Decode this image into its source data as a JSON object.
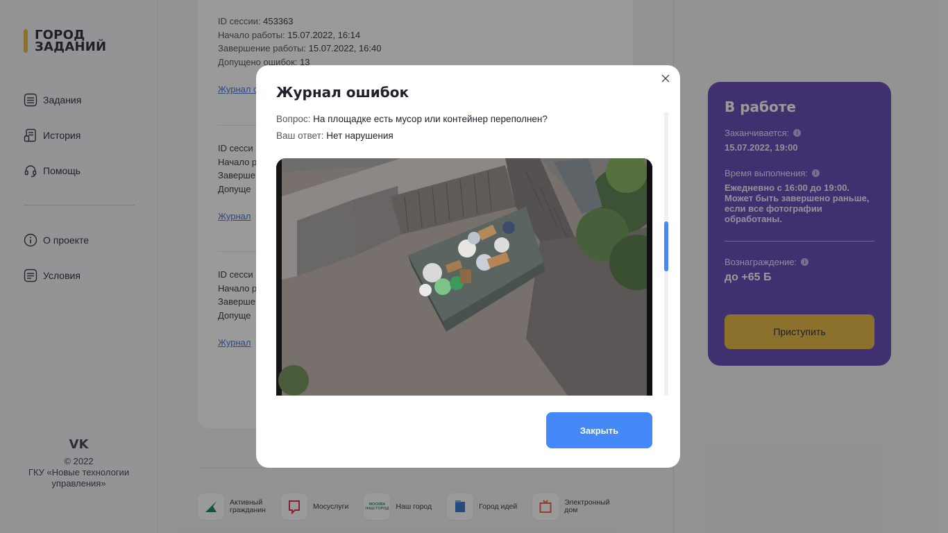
{
  "brand": {
    "logo_line1": "ГОРОД",
    "logo_line2": "ЗАДАНИЙ",
    "accent": "#e3b436"
  },
  "sidebar": {
    "items": [
      {
        "label": "Задания",
        "icon": "list-icon"
      },
      {
        "label": "История",
        "icon": "history-icon"
      },
      {
        "label": "Помощь",
        "icon": "headset-icon"
      }
    ],
    "secondary": [
      {
        "label": "О проекте",
        "icon": "info-icon"
      },
      {
        "label": "Условия",
        "icon": "document-icon"
      }
    ],
    "footer": {
      "vk": "VK",
      "copyright": "© 2022",
      "org": "ГКУ «Новые технологии управления»"
    }
  },
  "sessions": {
    "first": {
      "id_label": "ID сессии:",
      "id_value": "453363",
      "start_label": "Начало работы:",
      "start_value": "15.07.2022, 16:14",
      "end_label": "Завершение работы:",
      "end_value": "15.07.2022, 16:40",
      "errors_label": "Допущено ошибок:",
      "errors_value": "13",
      "journal_link": "Журнал ошибок"
    },
    "second": {
      "l1": "ID сесси",
      "l2": "Начало р",
      "l3": "Заверше",
      "l4": "Допуще",
      "link": "Журнал"
    },
    "third": {
      "l1": "ID сесси",
      "l2": "Начало р",
      "l3": "Заверше",
      "l4": "Допуще",
      "link": "Журнал"
    }
  },
  "partners": [
    {
      "name": "Активный гражданин",
      "line1": "Активный",
      "line2": "гражданин",
      "color": "#0b7c6e"
    },
    {
      "name": "Мосуслуги",
      "line1": "Мосуслуги",
      "line2": "",
      "color": "#d7263d"
    },
    {
      "name": "Наш город",
      "line1": "Наш город",
      "line2": "",
      "color": "#2b8a56",
      "logo_text_1": "МОСКВА",
      "logo_text_2": "НАШ ГОРОД"
    },
    {
      "name": "Город идей",
      "line1": "Город идей",
      "line2": "",
      "color": "#2a6fcc"
    },
    {
      "name": "Электронный дом",
      "line1": "Электронный",
      "line2": "дом",
      "color": "#e65c2c"
    }
  ],
  "status_card": {
    "title": "В работе",
    "ends_label": "Заканчивается:",
    "ends_value": "15.07.2022, 19:00",
    "time_label": "Время выполнения:",
    "time_value": "Ежедневно с 16:00 до 19:00. Может быть завершено раньше, если все фотографии обработаны.",
    "reward_label": "Вознаграждение:",
    "reward_value": "до +65 Б",
    "start_button": "Приступить",
    "bg_color": "#5b3fb3"
  },
  "modal": {
    "title": "Журнал ошибок",
    "question_label": "Вопрос:",
    "question_value": "На площадке есть мусор или контейнер переполнен?",
    "answer_label": "Ваш ответ:",
    "answer_value": "Нет нарушения",
    "close_button": "Закрыть",
    "accent": "#4489f7"
  }
}
